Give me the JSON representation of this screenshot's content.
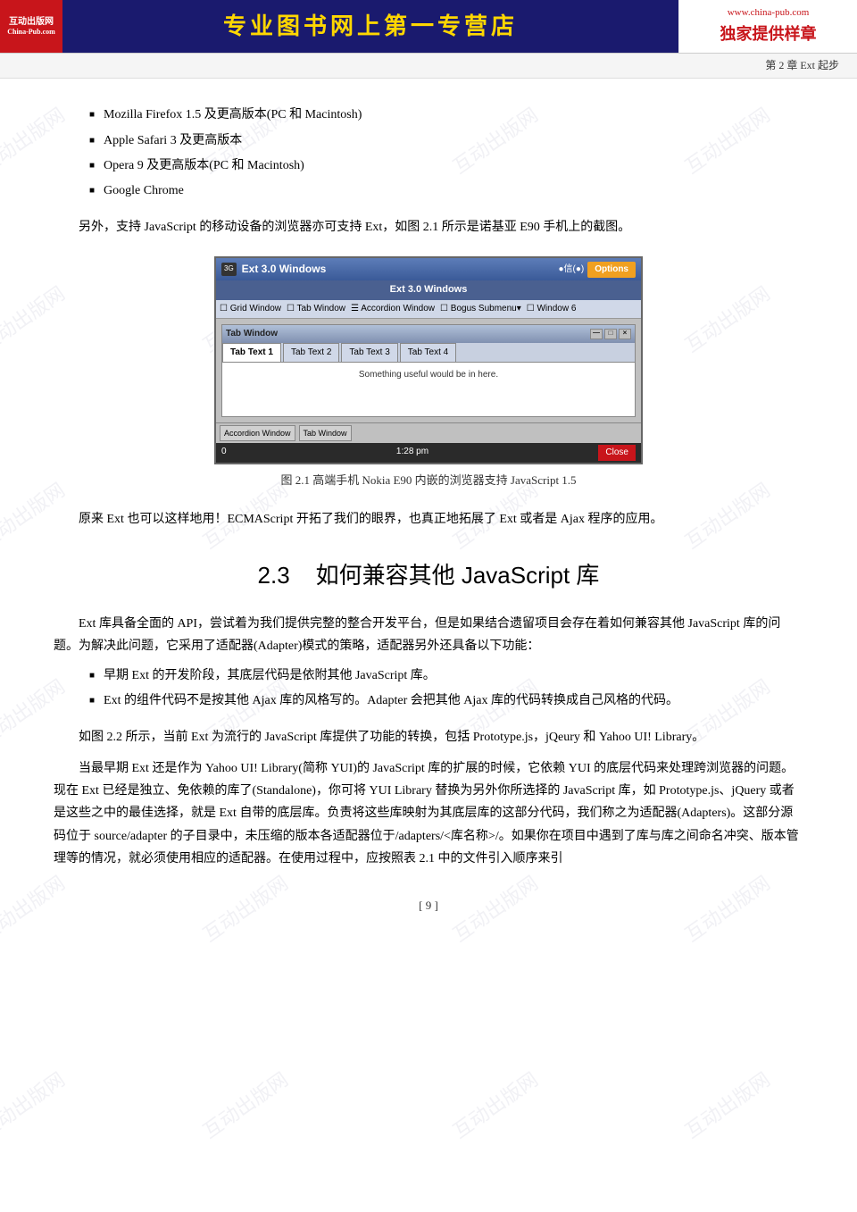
{
  "header": {
    "logo_line1": "互动出版网",
    "logo_line2": "China-Pub.com",
    "title": "专业图书网上第一专营店",
    "url": "www.china-pub.com",
    "slogan": "独家提供样章"
  },
  "chapter_bar": {
    "text": "第 2 章   Ext 起步"
  },
  "watermark": {
    "text": "互动出版网"
  },
  "bullet_items": [
    "Mozilla Firefox 1.5 及更高版本(PC 和 Macintosh)",
    "Apple Safari 3 及更高版本",
    "Opera 9 及更高版本(PC 和 Macintosh)",
    "Google Chrome"
  ],
  "para1": "另外，支持 JavaScript 的移动设备的浏览器亦可支持 Ext，如图 2.1 所示是诺基亚 E90 手机上的截图。",
  "figure": {
    "caption": "图 2.1    高端手机 Nokia E90 内嵌的浏览器支持 JavaScript 1.5",
    "screenshot": {
      "titlebar_icon": "3G",
      "titlebar_title": "Ext 3.0 Windows",
      "signal": "●信(●)",
      "options": "Options",
      "menubar": "Ext 3.0 Windows",
      "toolbar_items": [
        "Grid Window",
        "Tab Window",
        "Accordion Window",
        "Bogus Submenu▾",
        "Window 6"
      ],
      "inner_title": "Tab Window",
      "inner_controls": [
        "—",
        "□",
        "×"
      ],
      "tabs": [
        "Tab Text 1",
        "Tab Text 2",
        "Tab Text 3",
        "Tab Text 4"
      ],
      "content": "Something useful would be in here.",
      "bottom_items": [
        "Accordion Window",
        "Tab Window"
      ],
      "status_left": "0",
      "status_time": "1:28 pm",
      "status_close": "Close"
    }
  },
  "para2": "原来 Ext 也可以这样地用！ECMAScript 开拓了我们的眼界，也真正地拓展了 Ext 或者是 Ajax 程序的应用。",
  "section": {
    "number": "2.3",
    "title": "如何兼容其他 JavaScript 库"
  },
  "para3": "Ext 库具备全面的 API，尝试着为我们提供完整的整合开发平台，但是如果结合遗留项目会存在着如何兼容其他 JavaScript 库的问题。为解决此问题，它采用了适配器(Adapter)模式的策略，适配器另外还具备以下功能：",
  "bullet2_items": [
    "早期 Ext 的开发阶段，其底层代码是依附其他 JavaScript 库。",
    "Ext 的组件代码不是按其他 Ajax 库的风格写的。Adapter 会把其他 Ajax 库的代码转换成自己风格的代码。"
  ],
  "para4": "如图 2.2 所示，当前 Ext 为流行的 JavaScript 库提供了功能的转换，包括 Prototype.js，jQeury 和 Yahoo UI! Library。",
  "para5": "当最早期 Ext 还是作为 Yahoo UI! Library(简称 YUI)的 JavaScript 库的扩展的时候，它依赖 YUI 的底层代码来处理跨浏览器的问题。现在 Ext 已经是独立、免依赖的库了(Standalone)，你可将 YUI Library 替换为另外你所选择的 JavaScript 库，如 Prototype.js、jQuery 或者是这些之中的最佳选择，就是 Ext 自带的底层库。负责将这些库映射为其底层库的这部分代码，我们称之为适配器(Adapters)。这部分源码位于 source/adapter 的子目录中，未压缩的版本各适配器位于/adapters/<库名称>/。如果你在项目中遇到了库与库之间命名冲突、版本管理等的情况，就必须使用相应的适配器。在使用过程中，应按照表 2.1 中的文件引入顺序来引",
  "page_number": "[ 9 ]"
}
